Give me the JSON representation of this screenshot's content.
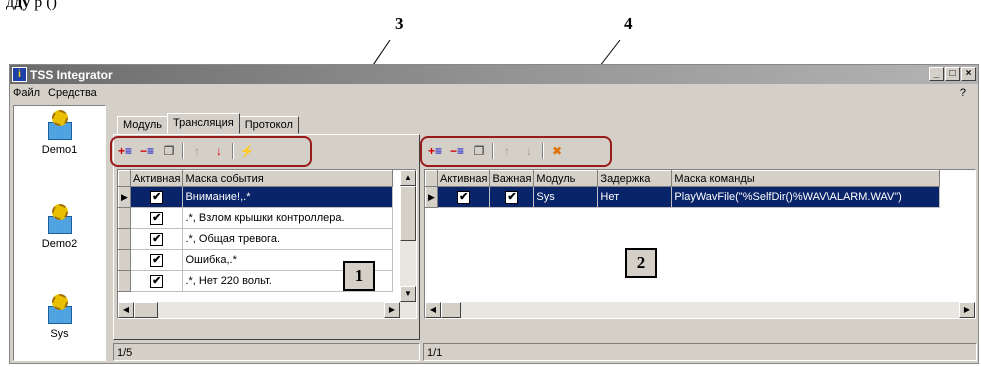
{
  "doc": {
    "text_before": "д",
    "text_bold": "ду",
    "text_mid": " р",
    "text_after": " (",
    "link": "",
    "closing": ")"
  },
  "callouts": [
    "3",
    "4",
    "1",
    "2"
  ],
  "window": {
    "title": "TSS Integrator",
    "buttons": [
      "_",
      "□",
      "×"
    ]
  },
  "menu": {
    "file": "Файл",
    "tools": "Средства",
    "help": "?"
  },
  "devices": [
    {
      "label": "Demo1"
    },
    {
      "label": "Demo2"
    },
    {
      "label": "Sys"
    }
  ],
  "tabs": [
    "Модуль",
    "Трансляция",
    "Протокол"
  ],
  "left_grid": {
    "columns": [
      "Активная",
      "Маска события"
    ],
    "rows": [
      {
        "active": "✔",
        "mask": "Внимание!,.*",
        "selected": true
      },
      {
        "active": "✔",
        "mask": ".*, Взлом крышки контроллера.",
        "selected": false
      },
      {
        "active": "✔",
        "mask": ".*, Общая тревога.",
        "selected": false
      },
      {
        "active": "✔",
        "mask": "Ошибка,.*",
        "selected": false
      },
      {
        "active": "✔",
        "mask": ".*, Нет 220 вольт.",
        "selected": false
      }
    ],
    "status": "1/5"
  },
  "right_grid": {
    "columns": [
      "Активная",
      "Важная",
      "Модуль",
      "Задержка",
      "Маска команды"
    ],
    "rows": [
      {
        "active": "✔",
        "important": "✔",
        "module": "Sys",
        "delay": "Нет",
        "mask": "PlayWavFile(\"%SelfDir()%WAV\\ALARM.WAV\")",
        "selected": true
      }
    ],
    "status": "1/1"
  },
  "colors": {
    "selection": "#0a246a",
    "callout_box": "#9b1a1a",
    "face": "#d4d0c8"
  }
}
